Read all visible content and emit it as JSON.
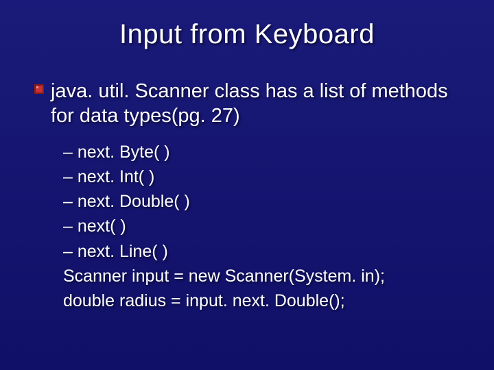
{
  "title": "Input from Keyboard",
  "main_point": "java. util. Scanner class has a list of methods for data types(pg. 27)",
  "sub_items": [
    "– next. Byte( )",
    "– next. Int( )",
    "– next. Double( )",
    "– next( )",
    "– next. Line( )",
    "Scanner input = new Scanner(System. in);",
    "double radius = input. next. Double();"
  ]
}
